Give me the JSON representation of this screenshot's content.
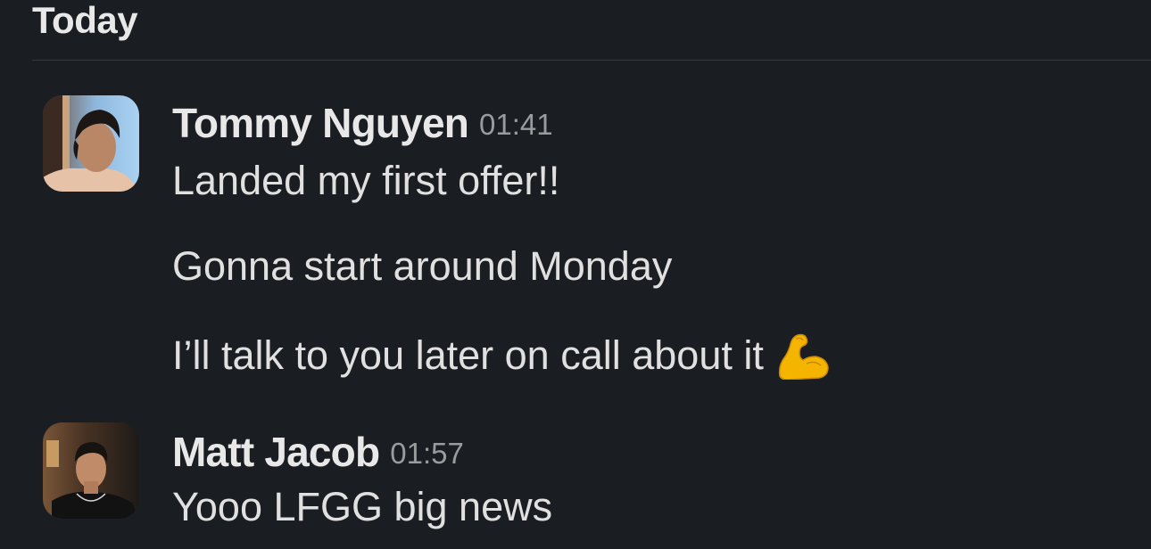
{
  "day_header": "Today",
  "messages": [
    {
      "sender": "Tommy Nguyen",
      "time": "01:41",
      "lines": [
        "Landed my first offer!!",
        "Gonna start around Monday",
        "I’ll talk to you later on call about it"
      ],
      "emoji": "flexed-biceps"
    },
    {
      "sender": "Matt Jacob",
      "time": "01:57",
      "lines": [
        "Yooo LFGG big news"
      ]
    }
  ],
  "colors": {
    "background": "#1a1d21",
    "text": "#e0e0e0",
    "timestamp": "#9a9b9d",
    "divider": "#35373b"
  }
}
